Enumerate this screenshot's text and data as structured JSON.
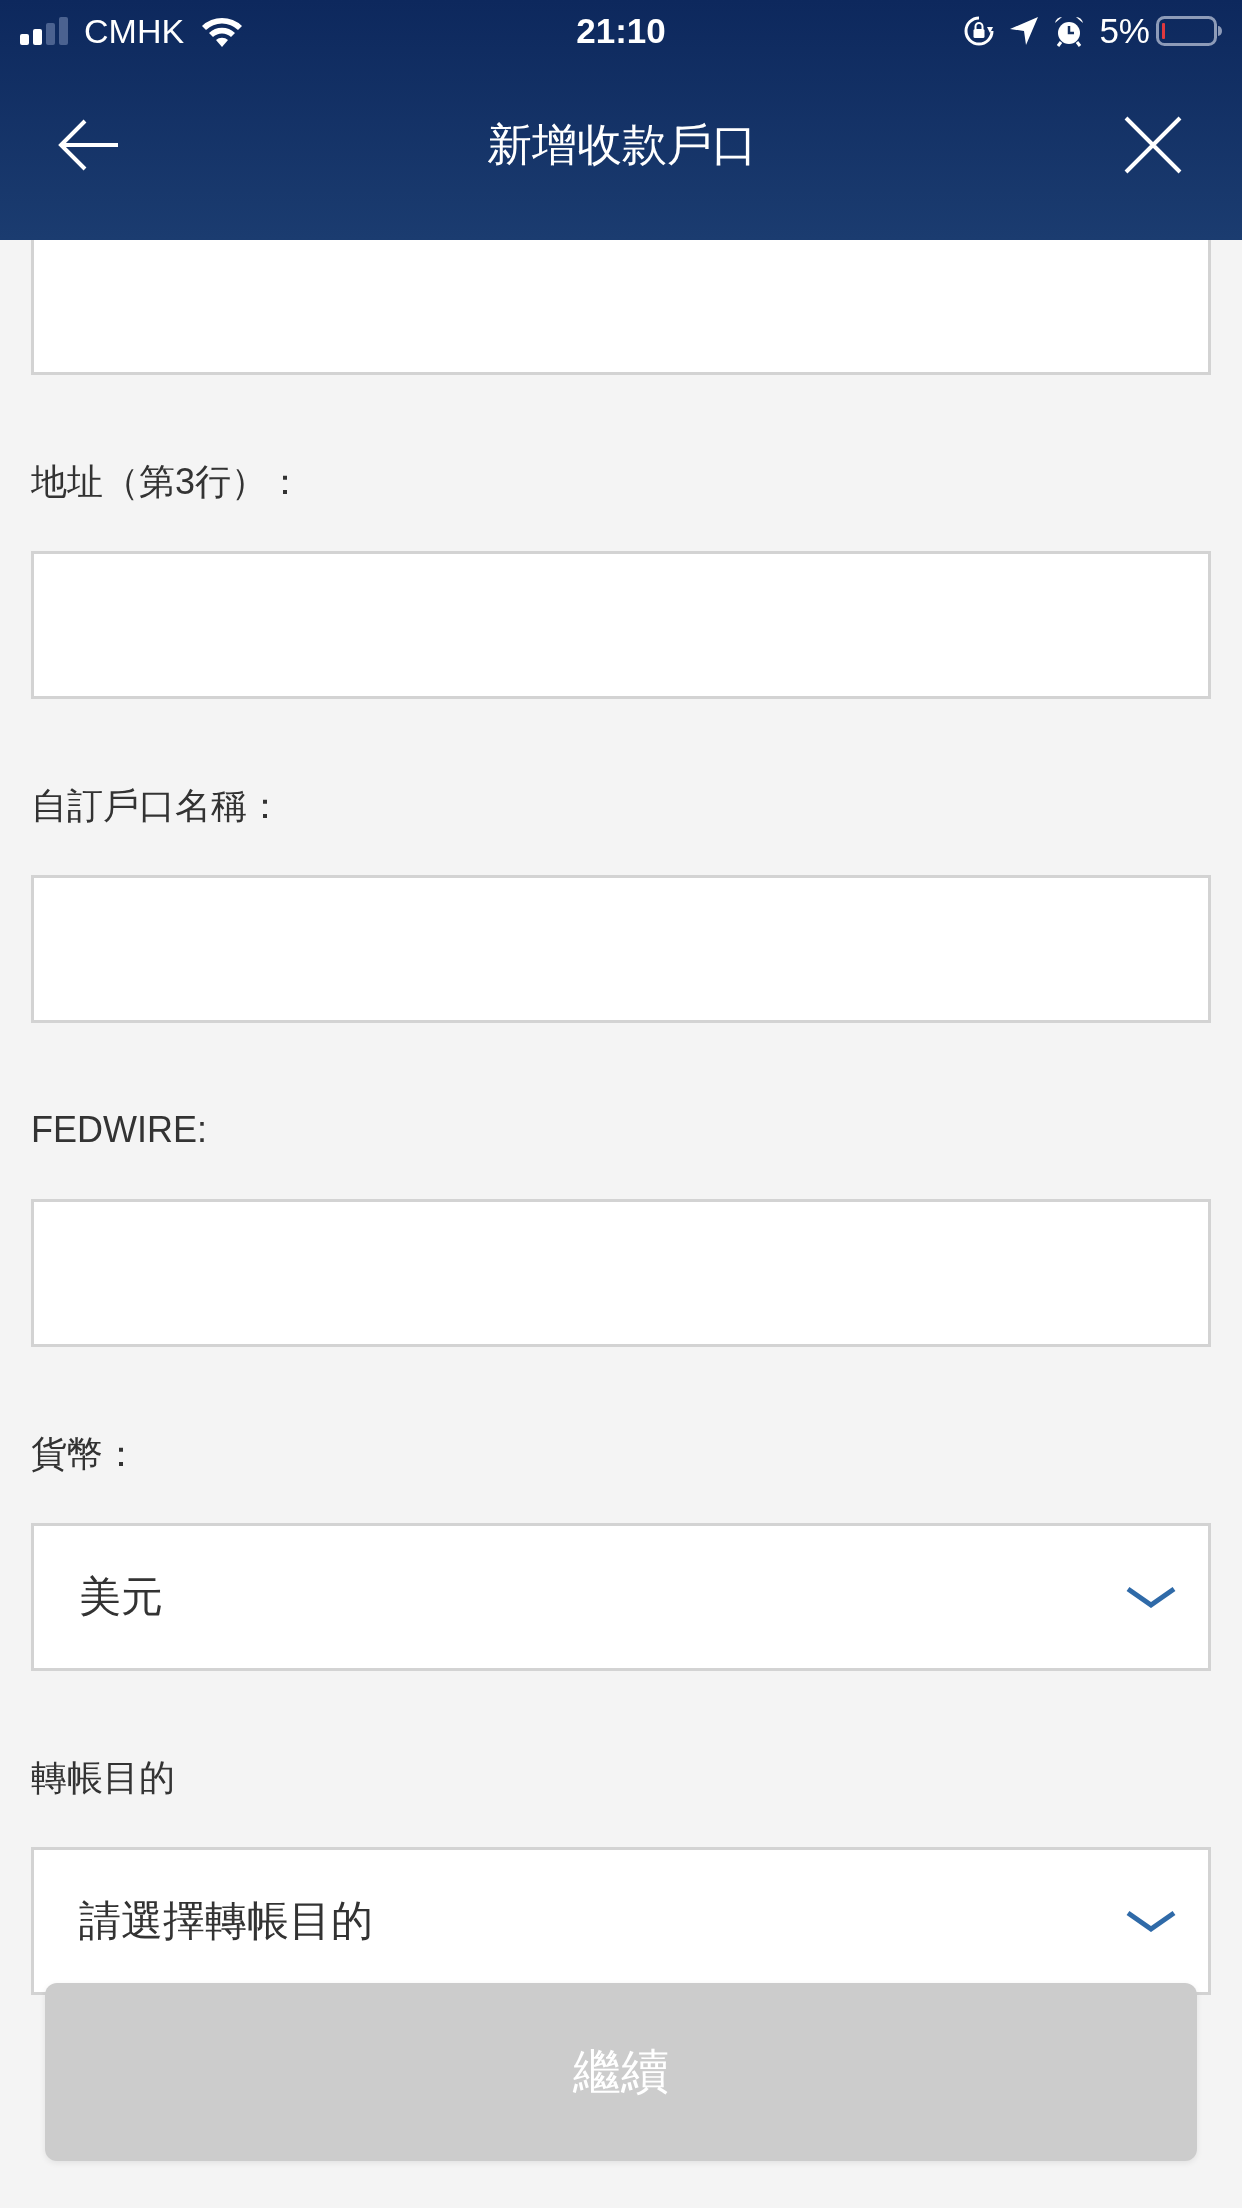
{
  "status_bar": {
    "carrier": "CMHK",
    "time": "21:10",
    "battery": "5%"
  },
  "nav_bar": {
    "title": "新增收款戶口"
  },
  "form": {
    "fields": [
      {
        "kind": "text"
      },
      {
        "kind": "text",
        "label": "地址（第3行）："
      },
      {
        "kind": "text",
        "label": "自訂戶口名稱："
      },
      {
        "kind": "text",
        "label": "FEDWIRE:"
      },
      {
        "kind": "select",
        "label": "貨幣：",
        "value": "美元"
      },
      {
        "kind": "select",
        "label": "轉帳目的",
        "placeholder": "請選擇轉帳目的"
      }
    ]
  },
  "button": {
    "label": "繼續",
    "disabled": true
  }
}
